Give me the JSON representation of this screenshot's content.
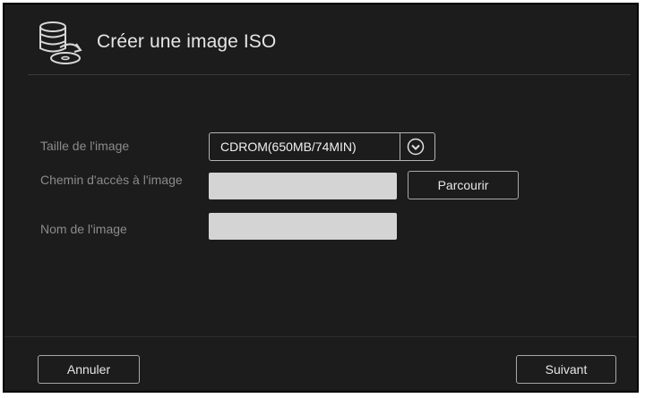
{
  "header": {
    "title": "Créer une image ISO",
    "icon": "disc-stack-icon"
  },
  "form": {
    "size_label": "Taille de l'image",
    "size_value": "CDROM(650MB/74MIN)",
    "path_label": "Chemin d'accès à l'image",
    "path_value": "",
    "name_label": "Nom de l'image",
    "name_value": "",
    "browse_label": "Parcourir"
  },
  "footer": {
    "cancel_label": "Annuler",
    "next_label": "Suivant"
  },
  "colors": {
    "background": "#1c1c1c",
    "input_fill": "#d4d4d4",
    "border": "#b4b4b4"
  }
}
